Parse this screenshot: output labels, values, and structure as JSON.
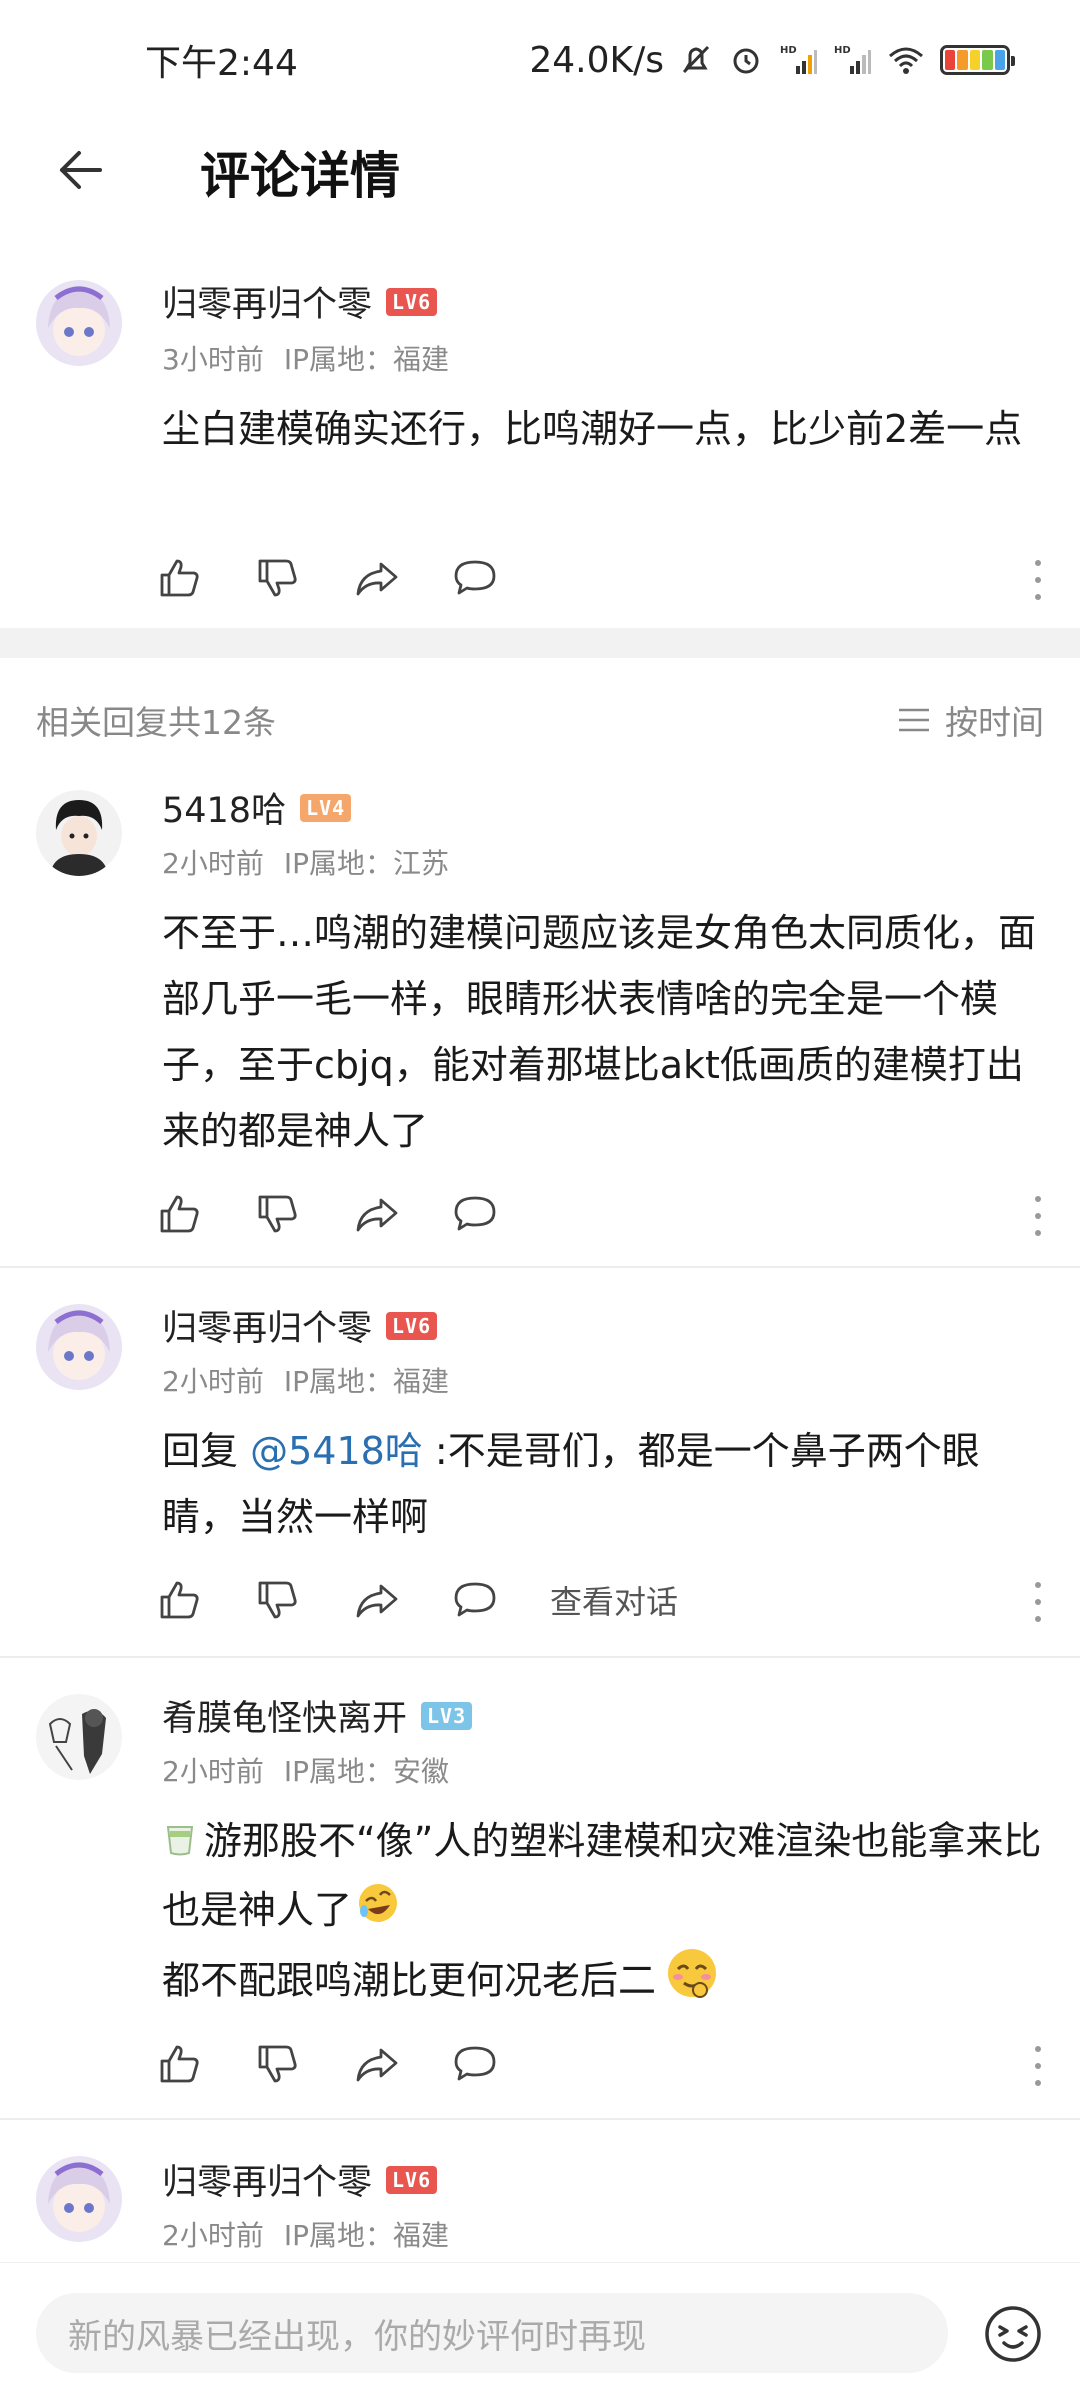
{
  "status_bar": {
    "time": "下午2:44",
    "speed": "24.0K/s",
    "icons": [
      "mute-bell-icon",
      "alarm-icon",
      "hd-signal-icon",
      "hd-signal-icon",
      "wifi-icon",
      "battery-icon"
    ]
  },
  "header": {
    "title": "评论详情",
    "back_icon": "back-arrow-icon"
  },
  "main_comment": {
    "username": "归零再归个零",
    "level": "LV6",
    "time": "3小时前",
    "ip": "IP属地：福建",
    "text": "尘白建模确实还行，比鸣潮好一点，比少前2差一点"
  },
  "replies_header": {
    "count_label": "相关回复共12条",
    "sort_label": "按时间"
  },
  "replies": [
    {
      "username": "5418哈",
      "level": "LV4",
      "time": "2小时前",
      "ip": "IP属地：江苏",
      "text": "不至于…鸣潮的建模问题应该是女角色太同质化，面部几乎一毛一样，眼睛形状表情啥的完全是一个模子，至于cbjq，能对着那堪比akt低画质的建模打出来的都是神人了"
    },
    {
      "username": "归零再归个零",
      "level": "LV6",
      "time": "2小时前",
      "ip": "IP属地：福建",
      "reply_prefix": "回复 ",
      "mention": "@5418哈",
      "text": " :不是哥们，都是一个鼻子两个眼睛，当然一样啊",
      "view_talk": "查看对话"
    },
    {
      "username": "肴膜龟怪快离开",
      "level": "LV3",
      "time": "2小时前",
      "ip": "IP属地：安徽",
      "line1": "游那股不“像”人的塑料建模和灾难渲染也能拿来比也是神人了",
      "line2": "都不配跟鸣潮比更何况老后二",
      "emojis": [
        "tea-emoji",
        "rofl-emoji",
        "drooling-emoji"
      ]
    },
    {
      "username": "归零再归个零",
      "level": "LV6",
      "time": "2小时前",
      "ip": "IP属地：福建"
    }
  ],
  "bottom_bar": {
    "placeholder": "新的风暴已经出现，你的妙评何时再现"
  },
  "colors": {
    "lv6": "#e8564f",
    "lv4": "#f5a66a",
    "lv3": "#7cc4e8",
    "mention": "#2a6fb0"
  }
}
